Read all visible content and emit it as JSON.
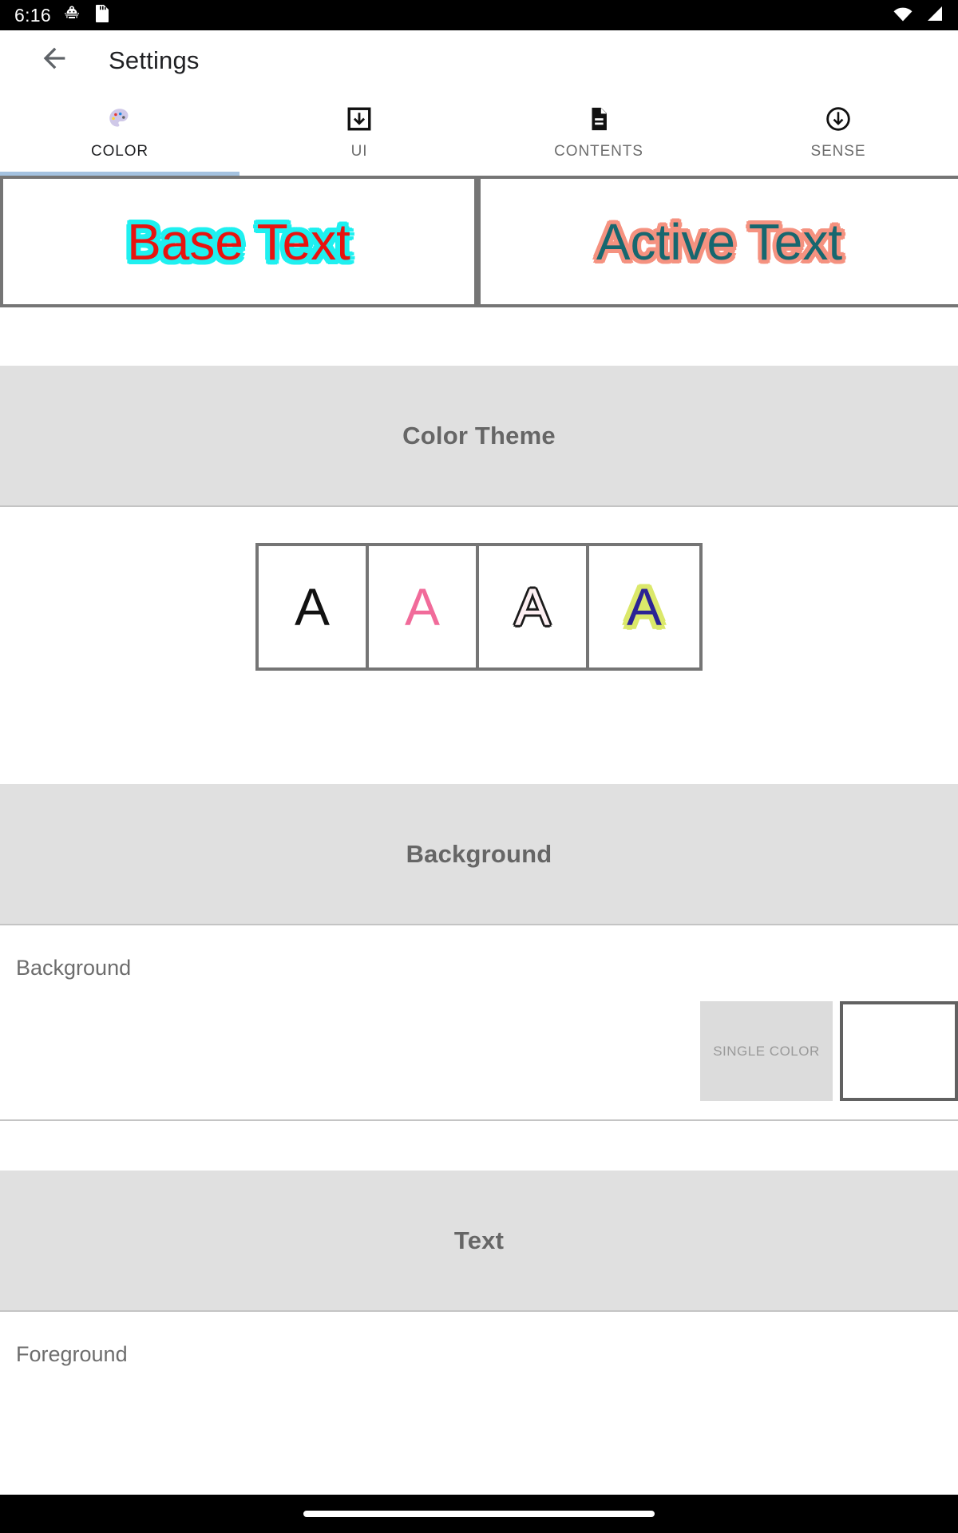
{
  "statusbar": {
    "time": "6:16",
    "icons": [
      "android-gear-icon",
      "sd-card-icon"
    ],
    "right_icons": [
      "wifi-icon",
      "cell-signal-icon"
    ]
  },
  "appbar": {
    "back_icon": "back-arrow-icon",
    "title": "Settings"
  },
  "tabs": [
    {
      "label": "COLOR",
      "icon": "palette-icon",
      "selected": true
    },
    {
      "label": "UI",
      "icon": "download-box-icon",
      "selected": false
    },
    {
      "label": "CONTENTS",
      "icon": "document-icon",
      "selected": false
    },
    {
      "label": "SENSE",
      "icon": "circle-down-arrow-icon",
      "selected": false
    }
  ],
  "preview": {
    "base": {
      "text": "Base Text",
      "fill": "#e8130f",
      "outline": "#1ff0f0"
    },
    "active": {
      "text": "Active Text",
      "fill": "#17676f",
      "outline": "#f59280"
    }
  },
  "sections": {
    "color_theme": {
      "title": "Color Theme",
      "swatches": [
        {
          "letter": "A",
          "name": "theme-mono",
          "fill": "#111111",
          "outline": ""
        },
        {
          "letter": "A",
          "name": "theme-pink",
          "fill": "#f16b9a",
          "outline": ""
        },
        {
          "letter": "A",
          "name": "theme-outline",
          "fill": "#fdeff2",
          "outline": "#1b1b1b"
        },
        {
          "letter": "A",
          "name": "theme-lime",
          "fill": "#2c2395",
          "outline": "#dbe86a"
        }
      ]
    },
    "background": {
      "title": "Background",
      "row_label": "Background",
      "mode_chip": "SINGLE COLOR",
      "color_value": "#ffffff"
    },
    "text": {
      "title": "Text",
      "row_label": "Foreground"
    }
  },
  "navbar": {
    "pill": "home-gesture-pill"
  },
  "colors": {
    "band": "#e0e0e0",
    "band_text": "#666666",
    "tab_indicator": "#a4c2e0",
    "border": "#757575"
  }
}
